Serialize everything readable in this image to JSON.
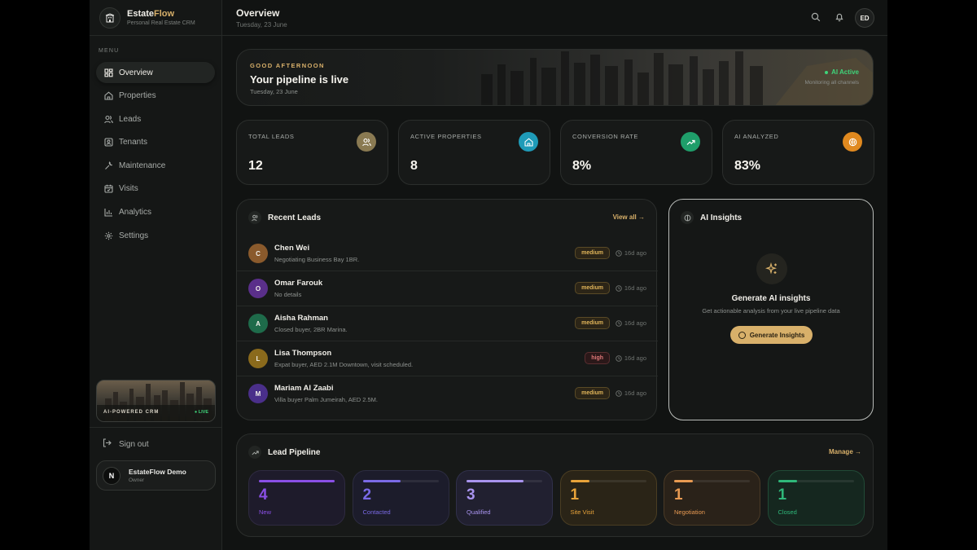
{
  "brand": {
    "name_prefix": "Estate",
    "name_accent": "Flow",
    "subtitle": "Personal Real Estate CRM"
  },
  "sidebar": {
    "menu_label": "MENU",
    "items": [
      {
        "label": "Overview",
        "icon": "grid-icon"
      },
      {
        "label": "Properties",
        "icon": "home-icon"
      },
      {
        "label": "Leads",
        "icon": "users-icon"
      },
      {
        "label": "Tenants",
        "icon": "id-card-icon"
      },
      {
        "label": "Maintenance",
        "icon": "wrench-icon"
      },
      {
        "label": "Visits",
        "icon": "calendar-icon"
      },
      {
        "label": "Analytics",
        "icon": "bar-chart-icon"
      },
      {
        "label": "Settings",
        "icon": "gear-icon"
      }
    ],
    "promo": {
      "tag": "AI-POWERED CRM",
      "live": "● LIVE"
    },
    "signout": "Sign out",
    "user": {
      "avatar": "N",
      "name": "EstateFlow Demo",
      "role": "Owner"
    }
  },
  "header": {
    "title": "Overview",
    "date": "Tuesday, 23 June",
    "avatar": "ED"
  },
  "hero": {
    "greeting": "GOOD AFTERNOON",
    "title": "Your pipeline is live",
    "date": "Tuesday, 23 June",
    "status": "AI Active",
    "status_sub": "Monitoring all channels"
  },
  "stats": [
    {
      "label": "TOTAL LEADS",
      "value": "12",
      "icon": "users-icon",
      "color": "#8a7a52"
    },
    {
      "label": "ACTIVE PROPERTIES",
      "value": "8",
      "icon": "home-icon",
      "color": "#1f9bb8"
    },
    {
      "label": "CONVERSION RATE",
      "value": "8%",
      "icon": "trending-up-icon",
      "color": "#1f9e6a"
    },
    {
      "label": "AI ANALYZED",
      "value": "83%",
      "icon": "brain-icon",
      "color": "#e0891f"
    }
  ],
  "recent_leads": {
    "title": "Recent Leads",
    "view_all": "View all →",
    "rows": [
      {
        "initial": "C",
        "name": "Chen Wei",
        "note": "Negotiating Business Bay 1BR.",
        "priority": "medium",
        "time": "16d ago",
        "color": "#8a5a2c"
      },
      {
        "initial": "O",
        "name": "Omar Farouk",
        "note": "No details",
        "priority": "medium",
        "time": "16d ago",
        "color": "#5a2f8a"
      },
      {
        "initial": "A",
        "name": "Aisha Rahman",
        "note": "Closed buyer, 2BR Marina.",
        "priority": "medium",
        "time": "16d ago",
        "color": "#1e6b4a"
      },
      {
        "initial": "L",
        "name": "Lisa Thompson",
        "note": "Expat buyer, AED 2.1M Downtown, visit scheduled.",
        "priority": "high",
        "time": "16d ago",
        "color": "#8a6a1c"
      },
      {
        "initial": "M",
        "name": "Mariam Al Zaabi",
        "note": "Villa buyer Palm Jumeirah, AED 2.5M.",
        "priority": "medium",
        "time": "16d ago",
        "color": "#4a2f8a"
      }
    ]
  },
  "ai_insights": {
    "title": "AI Insights",
    "heading": "Generate AI insights",
    "subtitle": "Get actionable analysis from your live pipeline data",
    "button": "Generate Insights"
  },
  "pipeline": {
    "title": "Lead Pipeline",
    "manage": "Manage →",
    "stages": [
      {
        "count": "4",
        "label": "New",
        "progress": 1.0,
        "color": "#8a4fe6",
        "bg": "#1e1b2b",
        "border": "#2e2a40"
      },
      {
        "count": "2",
        "label": "Contacted",
        "progress": 0.5,
        "color": "#7a6ae6",
        "bg": "#1c1c2b",
        "border": "#2c2c40"
      },
      {
        "count": "3",
        "label": "Qualified",
        "progress": 0.75,
        "color": "#a893ee",
        "bg": "#212030",
        "border": "#30304a"
      },
      {
        "count": "1",
        "label": "Site Visit",
        "progress": 0.25,
        "color": "#e8a33a",
        "bg": "#2a2417",
        "border": "#4a3d22"
      },
      {
        "count": "1",
        "label": "Negotiation",
        "progress": 0.25,
        "color": "#e89a52",
        "bg": "#2a2219",
        "border": "#4a3a26"
      },
      {
        "count": "1",
        "label": "Closed",
        "progress": 0.25,
        "color": "#2fb87a",
        "bg": "#15271f",
        "border": "#214a36"
      }
    ]
  }
}
